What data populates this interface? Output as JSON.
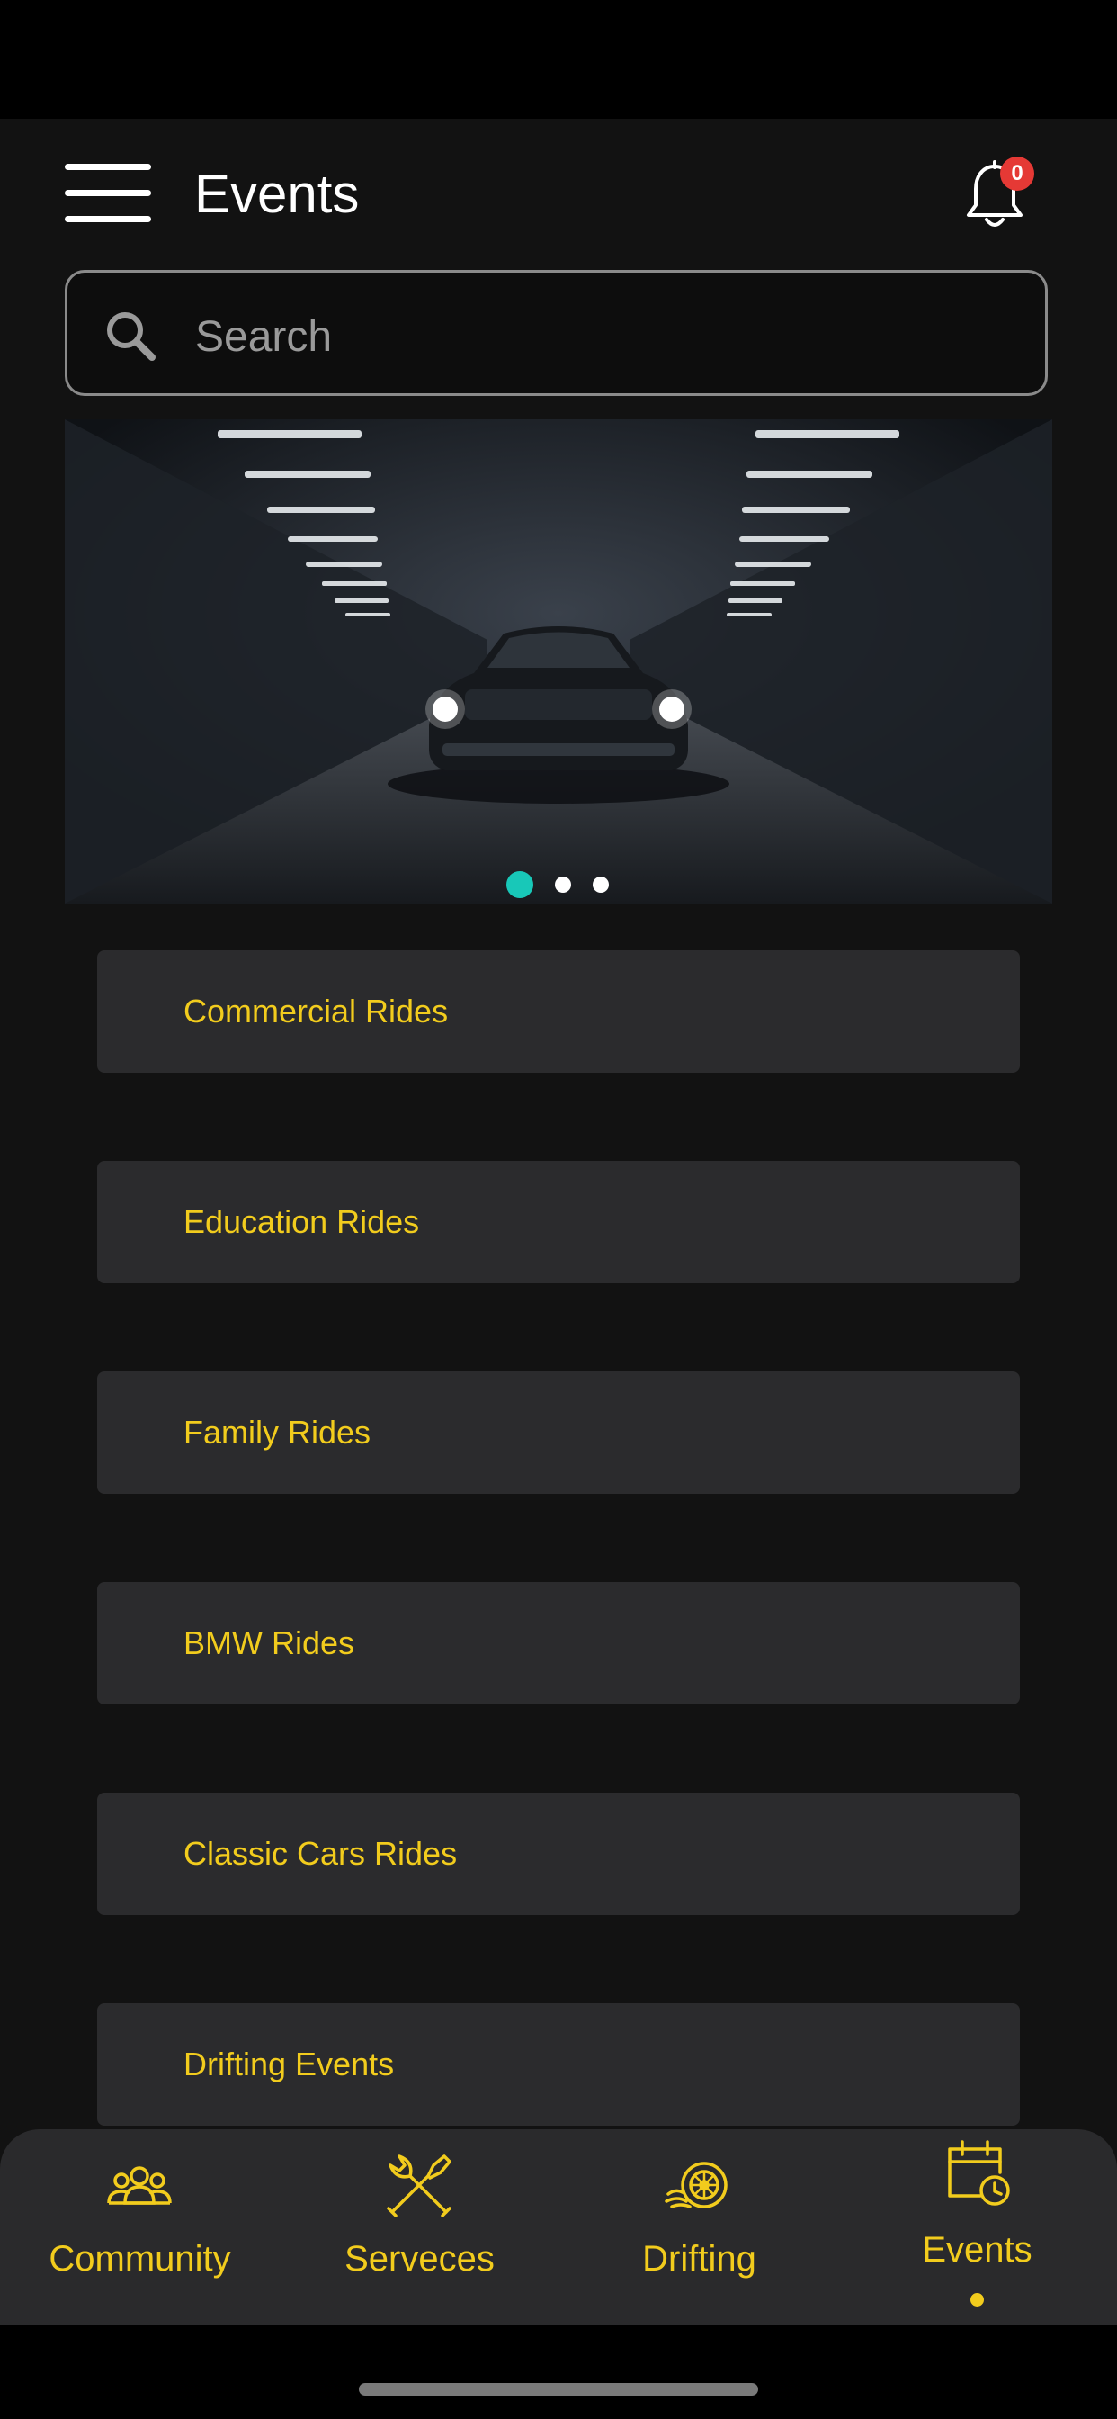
{
  "header": {
    "title": "Events",
    "notification_count": "0"
  },
  "search": {
    "placeholder": "Search",
    "value": ""
  },
  "banner": {
    "slide_count": 3,
    "active_slide": 1
  },
  "categories": [
    {
      "label": "Commercial Rides"
    },
    {
      "label": "Education Rides"
    },
    {
      "label": "Family Rides"
    },
    {
      "label": "BMW Rides"
    },
    {
      "label": "Classic Cars Rides"
    },
    {
      "label": "Drifting Events"
    }
  ],
  "bottom_nav": {
    "items": [
      {
        "label": "Community",
        "icon": "community-icon"
      },
      {
        "label": "Serveces",
        "icon": "tools-icon"
      },
      {
        "label": "Drifting",
        "icon": "drifting-icon"
      },
      {
        "label": "Events",
        "icon": "calendar-clock-icon"
      }
    ],
    "active": "Events"
  },
  "colors": {
    "background": "#121212",
    "accent": "#f2cc1d",
    "card": "#2b2b2d",
    "active_dot": "#18c8b8",
    "badge": "#e53935"
  }
}
